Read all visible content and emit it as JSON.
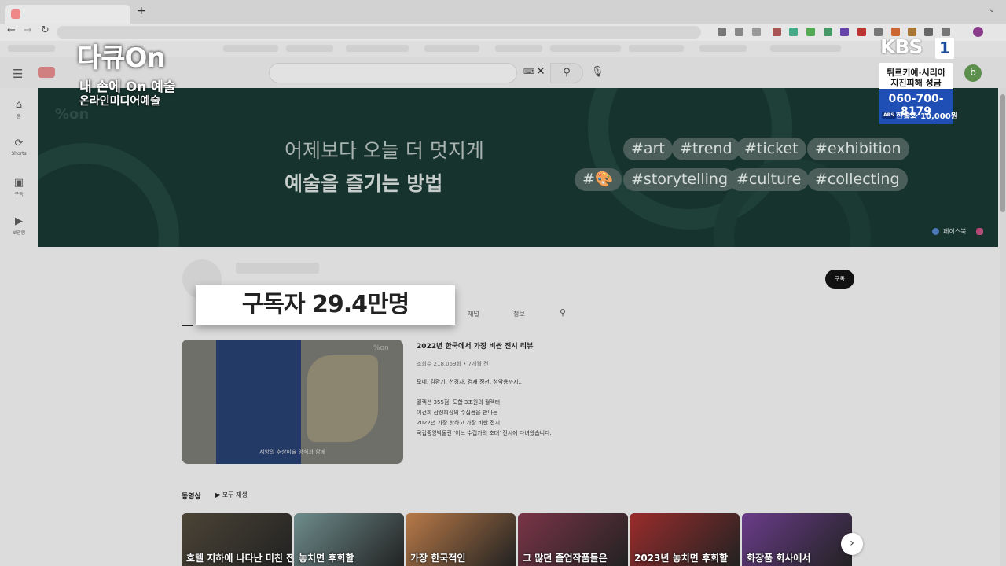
{
  "overlay": {
    "program_logo": "다큐On",
    "program_sub1": "내 손에 On 예술",
    "program_sub2": "온라인미디어예술",
    "broadcaster": "KBS",
    "broadcaster_num": "1",
    "donation_line1": "튀르키예·시리아",
    "donation_line2": "지진피해 성금",
    "donation_phone": "060-700-8179",
    "donation_ars": "ARS",
    "donation_fee": "한통화 10,000원"
  },
  "browser": {
    "new_tab": "+",
    "back": "←",
    "forward": "→",
    "reload": "↻"
  },
  "youtube": {
    "search_placeholder": "",
    "avatar_letter": "b",
    "nav": [
      {
        "icon": "home-icon",
        "glyph": "⌂",
        "label": "홈"
      },
      {
        "icon": "shorts-icon",
        "glyph": "⟳",
        "label": "Shorts"
      },
      {
        "icon": "subscriptions-icon",
        "glyph": "▣",
        "label": "구독"
      },
      {
        "icon": "library-icon",
        "glyph": "▶",
        "label": "보관함"
      }
    ]
  },
  "banner": {
    "logo": "%on",
    "tagline1": "어제보다 오늘 더 멋지게",
    "tagline2": "예술을 즐기는 방법",
    "tags_row1": [
      "#art",
      "#trend",
      "#ticket",
      "#exhibition"
    ],
    "tags_row2": [
      "#🎨",
      "#storytelling",
      "#culture",
      "#collecting"
    ],
    "link_facebook": "페이스북"
  },
  "channel": {
    "subscribe_label": "구독",
    "subscriber_caption": "구독자 29.4만명",
    "tabs": [
      "채널",
      "정보"
    ]
  },
  "featured": {
    "thumb_logo": "%on",
    "thumb_caption": "서양의 추상미술 양식과 함께",
    "title": "2022년 한국에서 가장 비싼 전시 리뷰",
    "meta": "조회수 218,059회 • 7개월 전",
    "desc": [
      "모네, 김환기, 천경자, 겸재 정선, 청악용까지..",
      "컬렉션 355점, 도합 3조원의 컬렉터",
      "이건희 삼성회장의 수집품을 만나는",
      "2022년 가장 핫하고 가장 비싼 전시",
      "국립중앙박물관 '어느 수집가의 초대' 전시에 다녀왔습니다."
    ]
  },
  "shelf": {
    "title": "동영상",
    "play_all": "모두 재생",
    "videos": [
      {
        "title": "호텔 지하에 나타난 미친 전시",
        "color": "#4b4436"
      },
      {
        "title": "놓치면 후회할",
        "color": "#6e8c8c"
      },
      {
        "title": "가장 한국적인",
        "color": "#b87a48"
      },
      {
        "title": "그 많던 졸업작품들은",
        "color": "#7a3448"
      },
      {
        "title": "2023년 놓치면 후회할",
        "color": "#9a2c2c"
      },
      {
        "title": "화장품 회사에서",
        "color": "#6a3c8a"
      }
    ]
  }
}
